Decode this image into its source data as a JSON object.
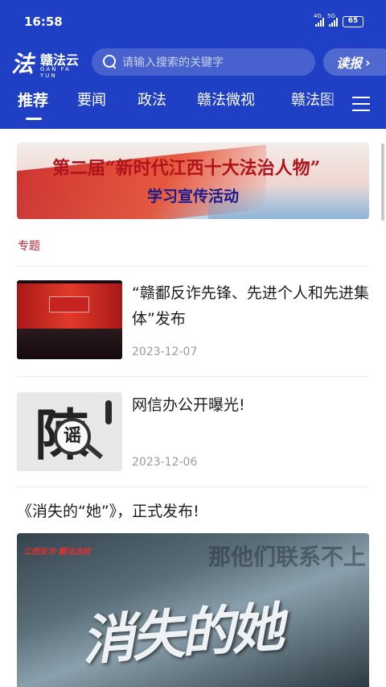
{
  "status": {
    "time": "16:58",
    "net1": "4G",
    "net2": "5G",
    "battery": "65"
  },
  "app": {
    "logo_mark": "法",
    "logo_name": "赣法云",
    "logo_sub": "GAN FA YUN",
    "search_placeholder": "请输入搜索的关键字",
    "read_label": "读报",
    "read_chevron": "›"
  },
  "tabs": [
    "推荐",
    "要闻",
    "政法",
    "赣法微视",
    "赣法图"
  ],
  "banner": {
    "line1": "第二届“新时代江西十大法治人物”",
    "line2": "学习宣传活动"
  },
  "section_label": "专题",
  "news": [
    {
      "title": "“赣鄱反诈先锋、先进个人和先进集体”发布",
      "date": "2023-12-07"
    },
    {
      "title": "网信办公开曝光!",
      "date": "2023-12-06",
      "thumb_text": "谣"
    }
  ],
  "feature": {
    "title": "《消失的“她”》，正式发布!",
    "video_tag": "江西反诈  翻法治软",
    "video_bg_text": "那他们联系不上",
    "video_main": "消失的她"
  },
  "colors": {
    "header_bg": "#1f3fc4",
    "section_label": "#b8223a",
    "date": "#9a9a9a"
  }
}
